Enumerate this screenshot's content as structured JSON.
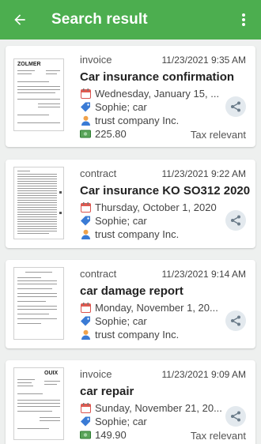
{
  "appbar": {
    "title": "Search result"
  },
  "colors": {
    "appbar": "#4cae4f",
    "card": "#ffffff",
    "background": "#eef0ef"
  },
  "results": [
    {
      "type": "invoice",
      "datetime": "11/23/2021 9:35 AM",
      "title": "Car insurance confirmation",
      "date": "Wednesday, January 15, ...",
      "tags": "Sophie; car",
      "company": "trust company Inc.",
      "amount": "225.80",
      "tax": "Tax relevant",
      "thumb_logo": "ZOLMER"
    },
    {
      "type": "contract",
      "datetime": "11/23/2021 9:22 AM",
      "title": "Car insurance KO SO312 2020",
      "date": "Thursday, October 1, 2020",
      "tags": "Sophie; car",
      "company": "trust company Inc."
    },
    {
      "type": "contract",
      "datetime": "11/23/2021 9:14 AM",
      "title": "car damage report",
      "date": "Monday, November 1, 20...",
      "tags": "Sophie; car",
      "company": "trust company Inc."
    },
    {
      "type": "invoice",
      "datetime": "11/23/2021 9:09 AM",
      "title": "car repair",
      "date": "Sunday, November 21, 20...",
      "tags": "Sophie; car",
      "amount": "149.90",
      "tax": "Tax relevant",
      "thumb_logo": "OUIX"
    }
  ]
}
